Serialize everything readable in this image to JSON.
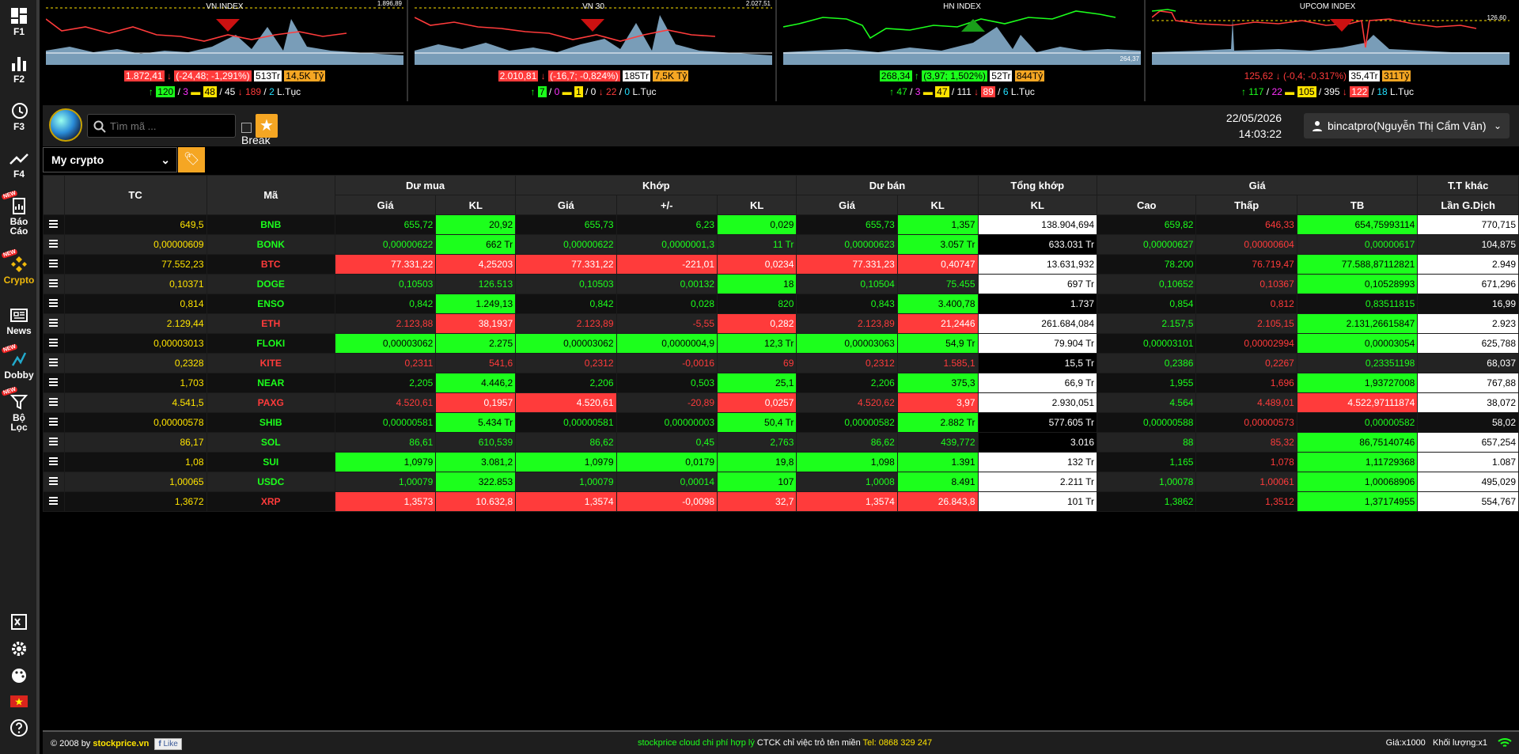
{
  "sidebar": {
    "items": [
      {
        "label": "F1",
        "icon": "dashboard-icon"
      },
      {
        "label": "F2",
        "icon": "bar-chart-icon"
      },
      {
        "label": "F3",
        "icon": "history-icon"
      },
      {
        "label": "F4",
        "icon": "trend-up-icon"
      },
      {
        "label": "Báo Cáo",
        "icon": "report-icon",
        "badge": "NEW"
      },
      {
        "label": "Crypto",
        "icon": "binance-icon",
        "badge": "NEW"
      },
      {
        "label": "News",
        "icon": "news-icon"
      },
      {
        "label": "Dobby",
        "icon": "dobby-icon",
        "badge": "NEW"
      },
      {
        "label": "Bộ Lọc",
        "icon": "filter-icon",
        "badge": "NEW"
      }
    ],
    "bottom_icons": [
      "excel-icon",
      "gear-icon",
      "palette-icon",
      "vietnam-flag-icon",
      "help-icon"
    ]
  },
  "indices": [
    {
      "name": "VN INDEX",
      "max": "1.896,89",
      "min": "",
      "value": "1.872,41",
      "change": "(-24,48; -1,291%)",
      "vol": "513Tr",
      "val": "14,5K Tỷ",
      "up": "120",
      "ceil": "3",
      "ref": "48",
      "total": "45",
      "down": "189",
      "floor": "2",
      "cont": "L.Tục",
      "dir": "down"
    },
    {
      "name": "VN 30",
      "max": "2.027,51",
      "min": "",
      "value": "2.010,81",
      "change": "(-16,7; -0,824%)",
      "vol": "185Tr",
      "val": "7,5K Tỷ",
      "up": "7",
      "ceil": "0",
      "ref": "1",
      "total": "0",
      "down": "22",
      "floor": "0",
      "cont": "L.Tục",
      "dir": "down"
    },
    {
      "name": "HN INDEX",
      "max": "",
      "min": "264,37",
      "value": "268,34",
      "change": "(3,97; 1,502%)",
      "vol": "52Tr",
      "val": "844Tỷ",
      "up": "47",
      "ceil": "3",
      "ref": "47",
      "total": "111",
      "down": "89",
      "floor": "6",
      "cont": "L.Tục",
      "dir": "up"
    },
    {
      "name": "UPCOM INDEX",
      "max": "126,60",
      "min": "",
      "value": "125,62",
      "change": "(-0,4; -0,317%)",
      "vol": "35,4Tr",
      "val": "311Tỷ",
      "up": "117",
      "ceil": "22",
      "ref": "105",
      "total": "395",
      "down": "122",
      "floor": "18",
      "cont": "L.Tục",
      "dir": "down"
    }
  ],
  "toolbar": {
    "search_placeholder": "Tìm mã ...",
    "break_label": "Break",
    "date": "22/05/2026",
    "time": "14:03:22",
    "user": "bincatpro(Nguyễn Thị Cẩm Vân)",
    "watchlist": "My crypto"
  },
  "headers": {
    "tc": "TC",
    "ma": "Mã",
    "du_mua": "Dư mua",
    "khop": "Khớp",
    "du_ban": "Dư bán",
    "tong_khop": "Tổng khớp",
    "gia": "Giá",
    "tt_khac": "T.T khác",
    "sub": [
      "Giá",
      "KL",
      "Giá",
      "+/-",
      "KL",
      "Giá",
      "KL",
      "KL",
      "Cao",
      "Thấp",
      "TB",
      "Lần G.Dịch"
    ]
  },
  "rows": [
    {
      "tc": "649,5",
      "sym": "BNB",
      "bp": "655,72",
      "bv": "20,92",
      "mp": "655,73",
      "chg": "6,23",
      "mv": "0,029",
      "sp": "655,73",
      "sv": "1,357",
      "tv": "138.904,694",
      "hi": "659,82",
      "lo": "646,33",
      "avg": "654,75993114",
      "cnt": "770,715"
    },
    {
      "tc": "0,00000609",
      "sym": "BONK",
      "bp": "0,00000622",
      "bv": "662 Tr",
      "mp": "0,00000622",
      "chg": "0,0000001,3",
      "mv": "11 Tr",
      "sp": "0,00000623",
      "sv": "3.057 Tr",
      "tv": "633.031 Tr",
      "hi": "0,00000627",
      "lo": "0,00000604",
      "avg": "0,00000617",
      "cnt": "104,875"
    },
    {
      "tc": "77.552,23",
      "sym": "BTC",
      "bp": "77.331,22",
      "bv": "4,25203",
      "mp": "77.331,22",
      "chg": "-221,01",
      "mv": "0,0234",
      "sp": "77.331,23",
      "sv": "0,40747",
      "tv": "13.631,932",
      "hi": "78.200",
      "lo": "76.719,47",
      "avg": "77.588,87112821",
      "cnt": "2.949"
    },
    {
      "tc": "0,10371",
      "sym": "DOGE",
      "bp": "0,10503",
      "bv": "126.513",
      "mp": "0,10503",
      "chg": "0,00132",
      "mv": "18",
      "sp": "0,10504",
      "sv": "75.455",
      "tv": "697 Tr",
      "hi": "0,10652",
      "lo": "0,10367",
      "avg": "0,10528993",
      "cnt": "671,296"
    },
    {
      "tc": "0,814",
      "sym": "ENSO",
      "bp": "0,842",
      "bv": "1.249,13",
      "mp": "0,842",
      "chg": "0,028",
      "mv": "820",
      "sp": "0,843",
      "sv": "3.400,78",
      "tv": "1.737",
      "hi": "0,854",
      "lo": "0,812",
      "avg": "0,83511815",
      "cnt": "16,99"
    },
    {
      "tc": "2.129,44",
      "sym": "ETH",
      "bp": "2.123,88",
      "bv": "38,1937",
      "mp": "2.123,89",
      "chg": "-5,55",
      "mv": "0,282",
      "sp": "2.123,89",
      "sv": "21,2446",
      "tv": "261.684,084",
      "hi": "2.157,5",
      "lo": "2.105,15",
      "avg": "2.131,26615847",
      "cnt": "2.923"
    },
    {
      "tc": "0,00003013",
      "sym": "FLOKI",
      "bp": "0,00003062",
      "bv": "2.275",
      "mp": "0,00003062",
      "chg": "0,0000004,9",
      "mv": "12,3 Tr",
      "sp": "0,00003063",
      "sv": "54,9 Tr",
      "tv": "79.904 Tr",
      "hi": "0,00003101",
      "lo": "0,00002994",
      "avg": "0,00003054",
      "cnt": "625,788"
    },
    {
      "tc": "0,2328",
      "sym": "KITE",
      "bp": "0,2311",
      "bv": "541,6",
      "mp": "0,2312",
      "chg": "-0,0016",
      "mv": "69",
      "sp": "0,2312",
      "sv": "1.585,1",
      "tv": "15,5 Tr",
      "hi": "0,2386",
      "lo": "0,2267",
      "avg": "0,23351198",
      "cnt": "68,037"
    },
    {
      "tc": "1,703",
      "sym": "NEAR",
      "bp": "2,205",
      "bv": "4.446,2",
      "mp": "2,206",
      "chg": "0,503",
      "mv": "25,1",
      "sp": "2,206",
      "sv": "375,3",
      "tv": "66,9 Tr",
      "hi": "1,955",
      "lo": "1,696",
      "avg": "1,93727008",
      "cnt": "767,88"
    },
    {
      "tc": "4.541,5",
      "sym": "PAXG",
      "bp": "4.520,61",
      "bv": "0,1957",
      "mp": "4.520,61",
      "chg": "-20,89",
      "mv": "0,0257",
      "sp": "4.520,62",
      "sv": "3,97",
      "tv": "2.930,051",
      "hi": "4.564",
      "lo": "4.489,01",
      "avg": "4.522,97111874",
      "cnt": "38,072"
    },
    {
      "tc": "0,00000578",
      "sym": "SHIB",
      "bp": "0,00000581",
      "bv": "5.434 Tr",
      "mp": "0,00000581",
      "chg": "0,00000003",
      "mv": "50,4 Tr",
      "sp": "0,00000582",
      "sv": "2.882 Tr",
      "tv": "577.605 Tr",
      "hi": "0,00000588",
      "lo": "0,00000573",
      "avg": "0,00000582",
      "cnt": "58,02"
    },
    {
      "tc": "86,17",
      "sym": "SOL",
      "bp": "86,61",
      "bv": "610,539",
      "mp": "86,62",
      "chg": "0,45",
      "mv": "2,763",
      "sp": "86,62",
      "sv": "439,772",
      "tv": "3.016",
      "hi": "88",
      "lo": "85,32",
      "avg": "86,75140746",
      "cnt": "657,254"
    },
    {
      "tc": "1,08",
      "sym": "SUI",
      "bp": "1,0979",
      "bv": "3.081,2",
      "mp": "1,0979",
      "chg": "0,0179",
      "mv": "19,8",
      "sp": "1,098",
      "sv": "1.391",
      "tv": "132 Tr",
      "hi": "1,165",
      "lo": "1,078",
      "avg": "1,11729368",
      "cnt": "1.087"
    },
    {
      "tc": "1,00065",
      "sym": "USDC",
      "bp": "1,00079",
      "bv": "322.853",
      "mp": "1,00079",
      "chg": "0,00014",
      "mv": "107",
      "sp": "1,0008",
      "sv": "8.491",
      "tv": "2.211 Tr",
      "hi": "1,00078",
      "lo": "1,00061",
      "avg": "1,00068906",
      "cnt": "495,029"
    },
    {
      "tc": "1,3672",
      "sym": "XRP",
      "bp": "1,3573",
      "bv": "10.632,8",
      "mp": "1,3574",
      "chg": "-0,0098",
      "mv": "32,7",
      "sp": "1,3574",
      "sv": "26.843,8",
      "tv": "101 Tr",
      "hi": "1,3862",
      "lo": "1,3512",
      "avg": "1,37174955",
      "cnt": "554,767"
    }
  ],
  "footer": {
    "copyright": "© 2008 by",
    "brand": "stockprice.vn",
    "like": "Like",
    "center_a": "stockprice cloud chi phí hợp lý",
    "center_b": "CTCK chỉ việc trỏ tên miền",
    "center_c": "Tel: 0868 329 247",
    "price_unit": "Giá:x1000",
    "vol_unit": "Khối lượng:x1"
  }
}
